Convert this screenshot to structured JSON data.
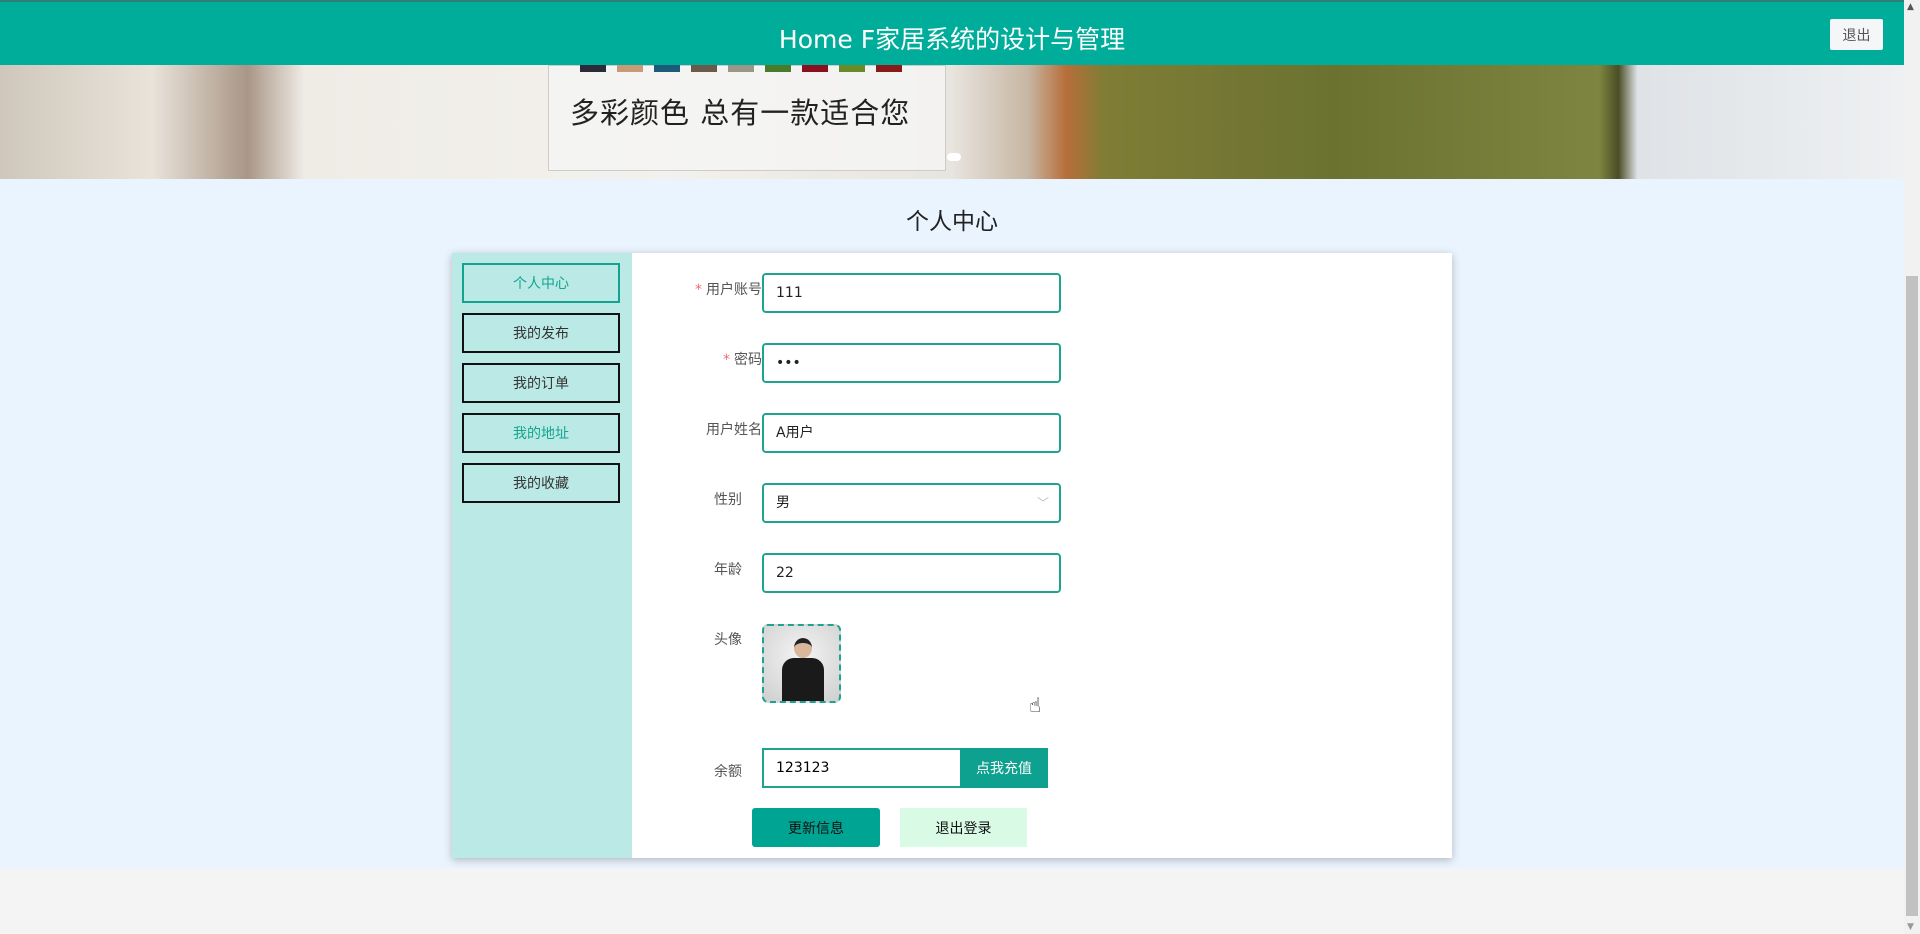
{
  "header": {
    "title": "Home F家居系统的设计与管理",
    "logout_label": "退出"
  },
  "banner": {
    "slogan": "多彩颜色 总有一款适合您",
    "swatch_colors": [
      "#2b2b3a",
      "#c89a78",
      "#1d5a7a",
      "#6b5a4a",
      "#9a9688",
      "#4a7a2a",
      "#8a1020",
      "#6a8a2a",
      "#8a1a1a"
    ]
  },
  "page_title": "个人中心",
  "sidebar": {
    "items": [
      {
        "label": "个人中心"
      },
      {
        "label": "我的发布"
      },
      {
        "label": "我的订单"
      },
      {
        "label": "我的地址"
      },
      {
        "label": "我的收藏"
      }
    ]
  },
  "form": {
    "account": {
      "label": "用户账号",
      "value": "111"
    },
    "password": {
      "label": "密码",
      "value": "•••"
    },
    "name": {
      "label": "用户姓名",
      "value": "A用户"
    },
    "gender": {
      "label": "性别",
      "value": "男"
    },
    "age": {
      "label": "年龄",
      "value": "22"
    },
    "avatar": {
      "label": "头像"
    },
    "balance": {
      "label": "余额",
      "value": "123123",
      "recharge_label": "点我充值"
    },
    "required_mark": "*",
    "update_label": "更新信息",
    "logout_label": "退出登录"
  },
  "colors": {
    "accent": "#00ad9a",
    "sidebar_bg": "#bbeae6",
    "page_bg": "#eaf4fe"
  }
}
